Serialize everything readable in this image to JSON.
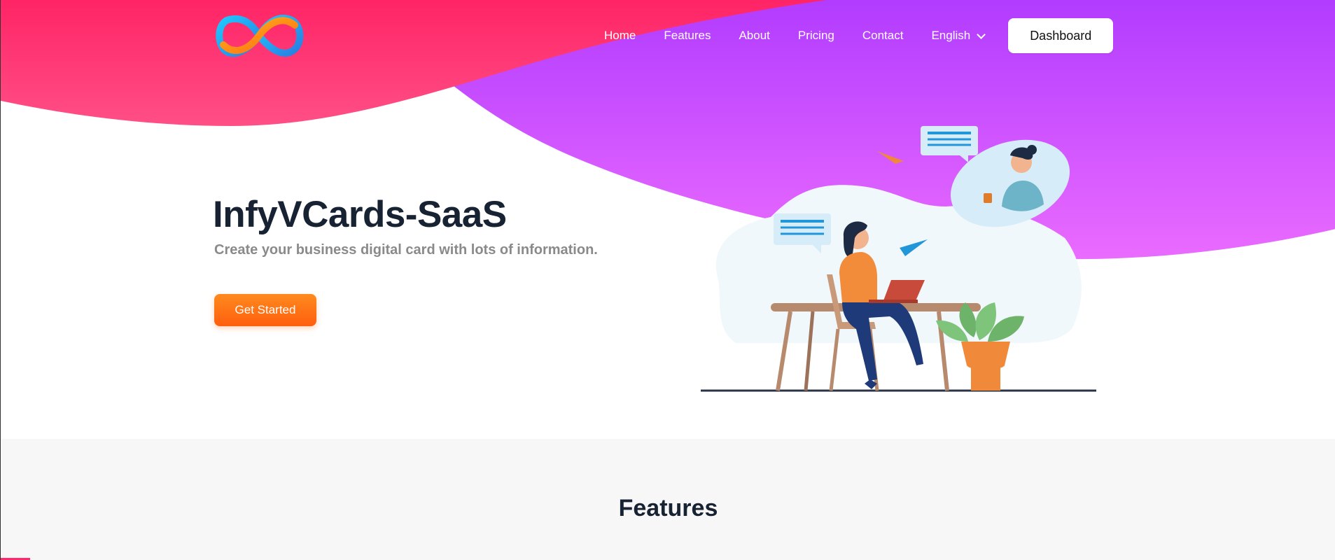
{
  "header": {
    "nav": [
      {
        "label": "Home"
      },
      {
        "label": "Features"
      },
      {
        "label": "About"
      },
      {
        "label": "Pricing"
      },
      {
        "label": "Contact"
      }
    ],
    "language": "English",
    "dashboard_label": "Dashboard"
  },
  "hero": {
    "title": "InfyVCards-SaaS",
    "subtitle": "Create your business digital card with lots of information.",
    "cta_label": "Get Started"
  },
  "features": {
    "title": "Features"
  },
  "icons": {
    "logo": "infinity-logo-icon",
    "language": "chevron-down-icon"
  },
  "colors": {
    "pink": "#ff2a6d",
    "purple": "#b040ff",
    "magenta": "#e264ff",
    "orange": "#ff6a14",
    "dark_text": "#172233",
    "muted_text": "#8a8a8a",
    "section_bg": "#f7f7f7"
  }
}
